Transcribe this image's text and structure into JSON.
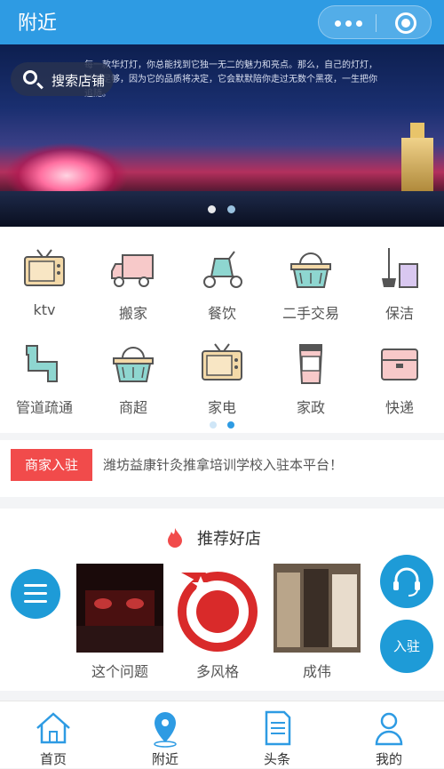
{
  "header": {
    "title": "附近",
    "menu_icon": "more-dots-icon",
    "close_icon": "target-icon"
  },
  "banner": {
    "search_label": "搜索店铺",
    "caption": "每一款华灯灯，你总能找到它独一无二的魅力和亮点。那么，自己的灯灯，就已足够，因为它的品质将决定，它会默默陪你走过无数个黑夜，一生把你追随。",
    "active_dot": 1
  },
  "categories": [
    {
      "label": "ktv",
      "icon": "tv-icon"
    },
    {
      "label": "搬家",
      "icon": "truck-icon"
    },
    {
      "label": "餐饮",
      "icon": "scooter-icon"
    },
    {
      "label": "二手交易",
      "icon": "basket-icon"
    },
    {
      "label": "保洁",
      "icon": "mop-bucket-icon"
    },
    {
      "label": "管道疏通",
      "icon": "pipe-icon"
    },
    {
      "label": "商超",
      "icon": "basket-icon"
    },
    {
      "label": "家电",
      "icon": "tv-icon"
    },
    {
      "label": "家政",
      "icon": "cup-icon"
    },
    {
      "label": "快递",
      "icon": "package-icon"
    }
  ],
  "category_page": 2,
  "notice": {
    "tag": "商家入驻",
    "message": "潍坊益康针灸推拿培训学校入驻本平台！"
  },
  "recommend": {
    "title": "推荐好店",
    "shops": [
      {
        "name": "这个问题"
      },
      {
        "name": "多风格"
      },
      {
        "name": "成伟"
      }
    ]
  },
  "fabs": {
    "join": "入驻",
    "service_icon": "headset-icon",
    "menu_icon": "menu-icon"
  },
  "tabbar": [
    {
      "label": "首页",
      "icon": "home-icon"
    },
    {
      "label": "附近",
      "icon": "location-pin-icon"
    },
    {
      "label": "头条",
      "icon": "document-icon"
    },
    {
      "label": "我的",
      "icon": "user-icon"
    }
  ],
  "colors": {
    "primary": "#2e9be3",
    "accent": "#1e9bd7",
    "tag_red": "#f14b4b"
  }
}
